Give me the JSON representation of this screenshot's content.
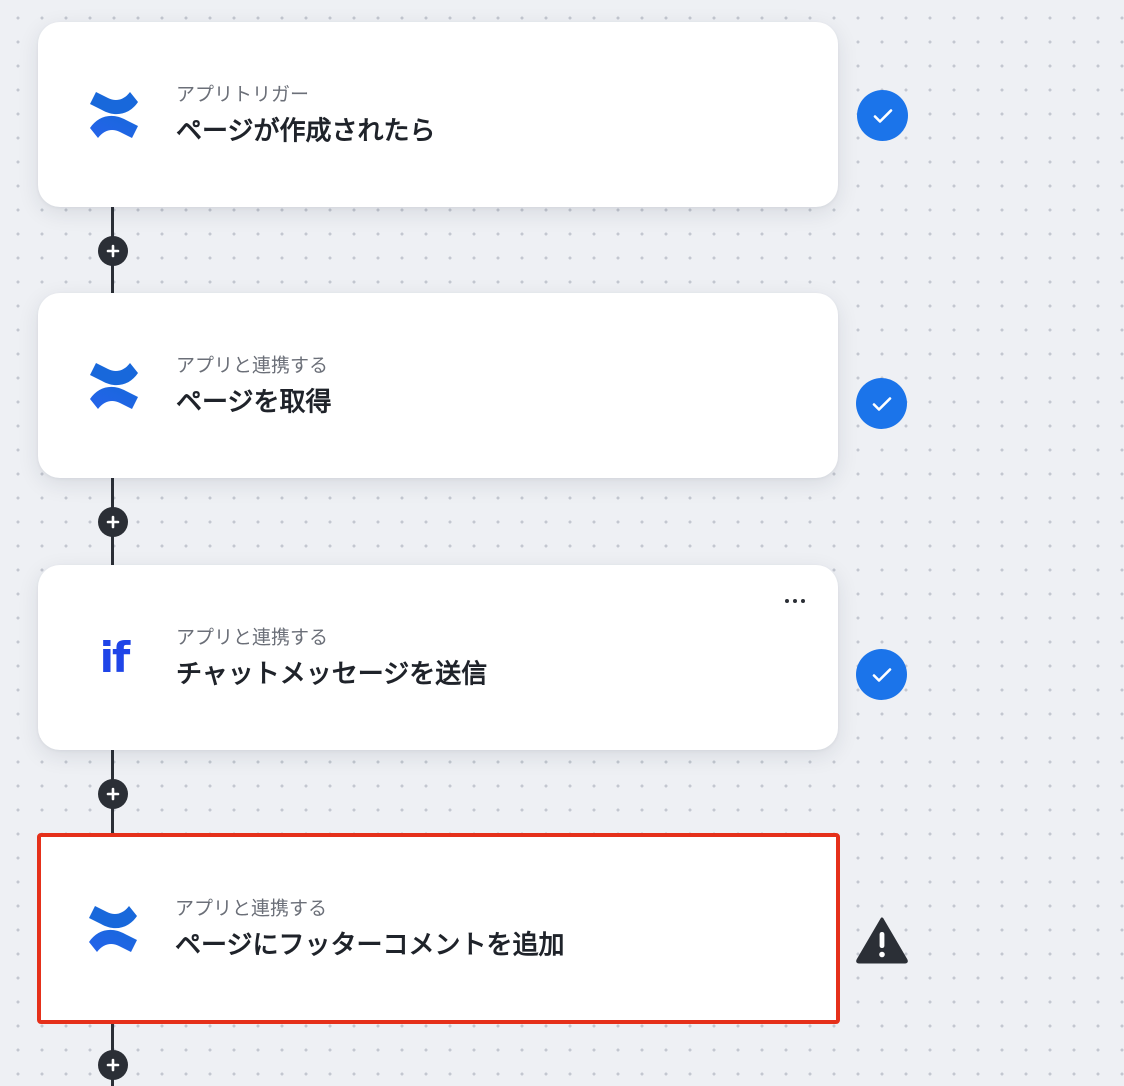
{
  "steps": [
    {
      "subtitle": "アプリトリガー",
      "title": "ページが作成されたら",
      "app_icon": "confluence-icon",
      "status": "complete",
      "status_icon": "check-circle-icon",
      "highlighted": false
    },
    {
      "subtitle": "アプリと連携する",
      "title": "ページを取得",
      "app_icon": "confluence-icon",
      "status": "complete",
      "status_icon": "check-circle-icon",
      "highlighted": false
    },
    {
      "subtitle": "アプリと連携する",
      "title": "チャットメッセージを送信",
      "app_icon": "if-logo-icon",
      "app_icon_text": "if",
      "status": "complete",
      "status_icon": "check-circle-icon",
      "highlighted": false,
      "has_menu": true
    },
    {
      "subtitle": "アプリと連携する",
      "title": "ページにフッターコメントを追加",
      "app_icon": "confluence-icon",
      "status": "warning",
      "status_icon": "warning-triangle-icon",
      "highlighted": true
    }
  ],
  "colors": {
    "check": "#1b74ea",
    "warning": "#2b2f36",
    "highlight_border": "#e5301a",
    "if_logo": "#1f45e8",
    "confluence": "#1868db"
  }
}
